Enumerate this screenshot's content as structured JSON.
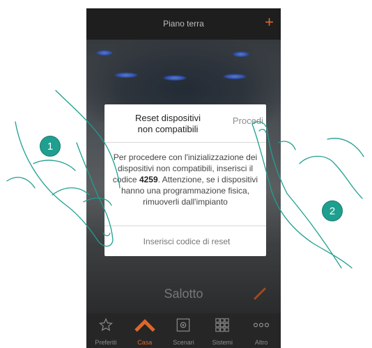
{
  "header": {
    "title": "Piano terra",
    "add_icon": "plus-icon",
    "accent": "#e0662b"
  },
  "room": {
    "label": "Salotto",
    "edit_icon": "pencil-icon"
  },
  "dialog": {
    "title_line1": "Reset dispositivi",
    "title_line2": "non compatibili",
    "action": "Procedi",
    "body_part1": "Per procedere con l'inizializzazione dei dispositivi non compatibili, inserisci il codice ",
    "code": "4259",
    "body_part2": ". Attenzione, se i dispositivi hanno una programmazione fisica, rimuoverli dall'impianto",
    "input_placeholder": "Inserisci codice di reset"
  },
  "tabs": [
    {
      "label": "Preferiti",
      "icon": "star-icon"
    },
    {
      "label": "Casa",
      "icon": "home-icon"
    },
    {
      "label": "Scenari",
      "icon": "scenario-gear-icon"
    },
    {
      "label": "Sistemi",
      "icon": "grid-icon"
    },
    {
      "label": "Altro",
      "icon": "more-icon"
    }
  ],
  "steps": [
    {
      "number": "1"
    },
    {
      "number": "2"
    }
  ],
  "colors": {
    "badge": "#1f9f8f",
    "tab_active": "#e0662b"
  }
}
